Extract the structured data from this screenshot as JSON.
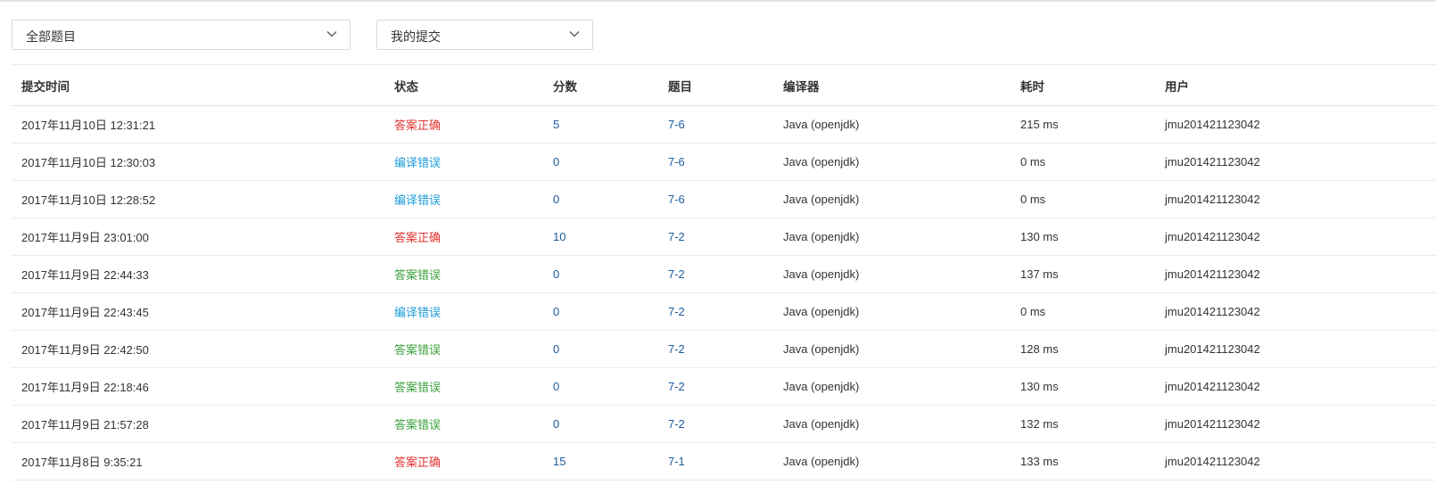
{
  "filters": {
    "problem_select": "全部题目",
    "scope_select": "我的提交"
  },
  "colors": {
    "accepted": "#e3342f",
    "compile_error": "#1c9cd8",
    "wrong_answer": "#3ba03b",
    "link": "#1c5a9c"
  },
  "table": {
    "headers": [
      "提交时间",
      "状态",
      "分数",
      "题目",
      "编译器",
      "耗时",
      "用户"
    ],
    "rows": [
      {
        "time": "2017年11月10日 12:31:21",
        "status": "答案正确",
        "status_type": "st-ac",
        "score": "5",
        "problem": "7-6",
        "compiler": "Java (openjdk)",
        "elapsed": "215 ms",
        "user": "jmu201421123042"
      },
      {
        "time": "2017年11月10日 12:30:03",
        "status": "编译错误",
        "status_type": "st-ce",
        "score": "0",
        "problem": "7-6",
        "compiler": "Java (openjdk)",
        "elapsed": "0 ms",
        "user": "jmu201421123042"
      },
      {
        "time": "2017年11月10日 12:28:52",
        "status": "编译错误",
        "status_type": "st-ce",
        "score": "0",
        "problem": "7-6",
        "compiler": "Java (openjdk)",
        "elapsed": "0 ms",
        "user": "jmu201421123042"
      },
      {
        "time": "2017年11月9日 23:01:00",
        "status": "答案正确",
        "status_type": "st-ac",
        "score": "10",
        "problem": "7-2",
        "compiler": "Java (openjdk)",
        "elapsed": "130 ms",
        "user": "jmu201421123042"
      },
      {
        "time": "2017年11月9日 22:44:33",
        "status": "答案错误",
        "status_type": "st-wa",
        "score": "0",
        "problem": "7-2",
        "compiler": "Java (openjdk)",
        "elapsed": "137 ms",
        "user": "jmu201421123042"
      },
      {
        "time": "2017年11月9日 22:43:45",
        "status": "编译错误",
        "status_type": "st-ce",
        "score": "0",
        "problem": "7-2",
        "compiler": "Java (openjdk)",
        "elapsed": "0 ms",
        "user": "jmu201421123042"
      },
      {
        "time": "2017年11月9日 22:42:50",
        "status": "答案错误",
        "status_type": "st-wa",
        "score": "0",
        "problem": "7-2",
        "compiler": "Java (openjdk)",
        "elapsed": "128 ms",
        "user": "jmu201421123042"
      },
      {
        "time": "2017年11月9日 22:18:46",
        "status": "答案错误",
        "status_type": "st-wa",
        "score": "0",
        "problem": "7-2",
        "compiler": "Java (openjdk)",
        "elapsed": "130 ms",
        "user": "jmu201421123042"
      },
      {
        "time": "2017年11月9日 21:57:28",
        "status": "答案错误",
        "status_type": "st-wa",
        "score": "0",
        "problem": "7-2",
        "compiler": "Java (openjdk)",
        "elapsed": "132 ms",
        "user": "jmu201421123042"
      },
      {
        "time": "2017年11月8日 9:35:21",
        "status": "答案正确",
        "status_type": "st-ac",
        "score": "15",
        "problem": "7-1",
        "compiler": "Java (openjdk)",
        "elapsed": "133 ms",
        "user": "jmu201421123042"
      }
    ]
  }
}
